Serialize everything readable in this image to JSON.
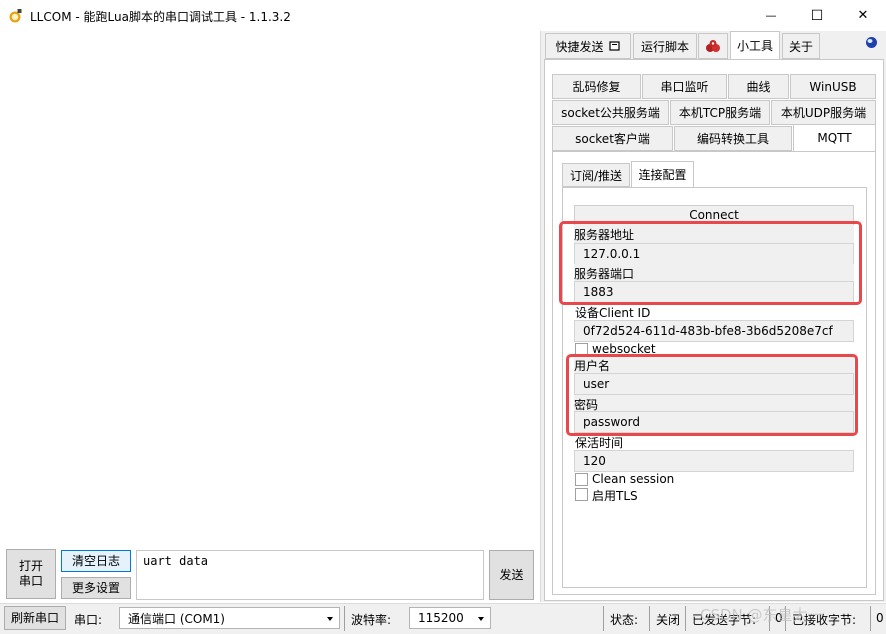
{
  "window": {
    "title": "LLCOM - 能跑Lua脚本的串口调试工具 - 1.1.3.2",
    "minimize_glyph": "—",
    "maximize_glyph": "☐",
    "close_glyph": "✕"
  },
  "main_tabs": [
    {
      "label": "快捷发送",
      "active": false
    },
    {
      "label": "运行脚本",
      "active": false
    },
    {
      "label": "",
      "active": false
    },
    {
      "label": "小工具",
      "active": true
    },
    {
      "label": "关于",
      "active": false
    }
  ],
  "tool_tabs": {
    "row1": [
      "乱码修复",
      "串口监听",
      "曲线",
      "WinUSB"
    ],
    "row2": [
      "socket公共服务端",
      "本机TCP服务端",
      "本机UDP服务端"
    ],
    "row3": [
      "socket客户端",
      "编码转换工具",
      "MQTT"
    ]
  },
  "mqtt_tabs": [
    "订阅/推送",
    "连接配置"
  ],
  "connect": {
    "button_label": "Connect",
    "server_address_label": "服务器地址",
    "server_address": "127.0.0.1",
    "server_port_label": "服务器端口",
    "server_port": "1883",
    "client_id_label": "设备Client ID",
    "client_id": "0f72d524-611d-483b-bfe8-3b6d5208e7cf",
    "websocket_label": "websocket",
    "username_label": "用户名",
    "username": "user",
    "password_label": "密码",
    "password": "password",
    "keepalive_label": "保活时间",
    "keepalive": "120",
    "clean_session_label": "Clean session",
    "tls_label": "启用TLS"
  },
  "bottom": {
    "open_port": "打开\n串口",
    "clear_log": "清空日志",
    "more_settings": "更多设置",
    "send_text": "uart data",
    "send_button": "发送"
  },
  "statusbar": {
    "refresh": "刷新串口",
    "port_label": "串口:",
    "port_value": "通信端口 (COM1)",
    "baud_label": "波特率:",
    "baud_value": "115200",
    "status_label": "状态:",
    "status_value": "关闭",
    "sent_label": "已发送字节:",
    "sent_value": "0",
    "recv_label": "已接收字节:",
    "recv_value": "0"
  },
  "watermark": "CSDN @东皇太一",
  "colors": {
    "highlight_border": "#e8474c",
    "panel_bg": "#f0f0f0",
    "selected_button_border": "#0078d7"
  }
}
